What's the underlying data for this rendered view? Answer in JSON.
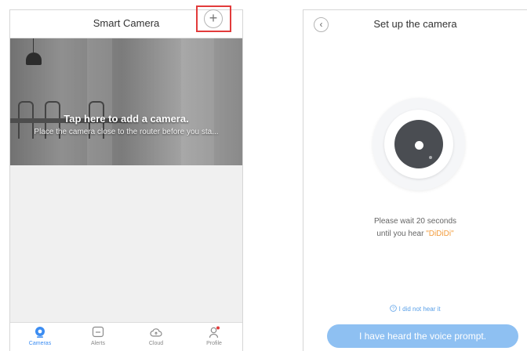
{
  "left_screen": {
    "title": "Smart Camera",
    "add_icon": "plus-circle-icon",
    "banner": {
      "title": "Tap here to add a camera.",
      "subtitle": "Place the camera close to the router before you sta..."
    },
    "tabs": [
      {
        "label": "Cameras",
        "icon": "camera-icon",
        "active": true
      },
      {
        "label": "Alerts",
        "icon": "message-icon",
        "active": false
      },
      {
        "label": "Cloud",
        "icon": "cloud-icon",
        "active": false
      },
      {
        "label": "Profile",
        "icon": "user-icon",
        "active": false
      }
    ]
  },
  "right_screen": {
    "back_icon": "back-chevron-icon",
    "title": "Set up the camera",
    "wait_line1": "Please wait 20 seconds",
    "wait_line2_prefix": "until you hear ",
    "wait_line2_highlight": "\"DiDiDi\"",
    "help_link": "I did not hear it",
    "primary_button": "I have heard the voice prompt."
  },
  "colors": {
    "accent_blue": "#3c8df2",
    "button_blue": "#8ec0f2",
    "highlight_orange": "#f39c3c",
    "callout_red": "#e23b3b"
  }
}
